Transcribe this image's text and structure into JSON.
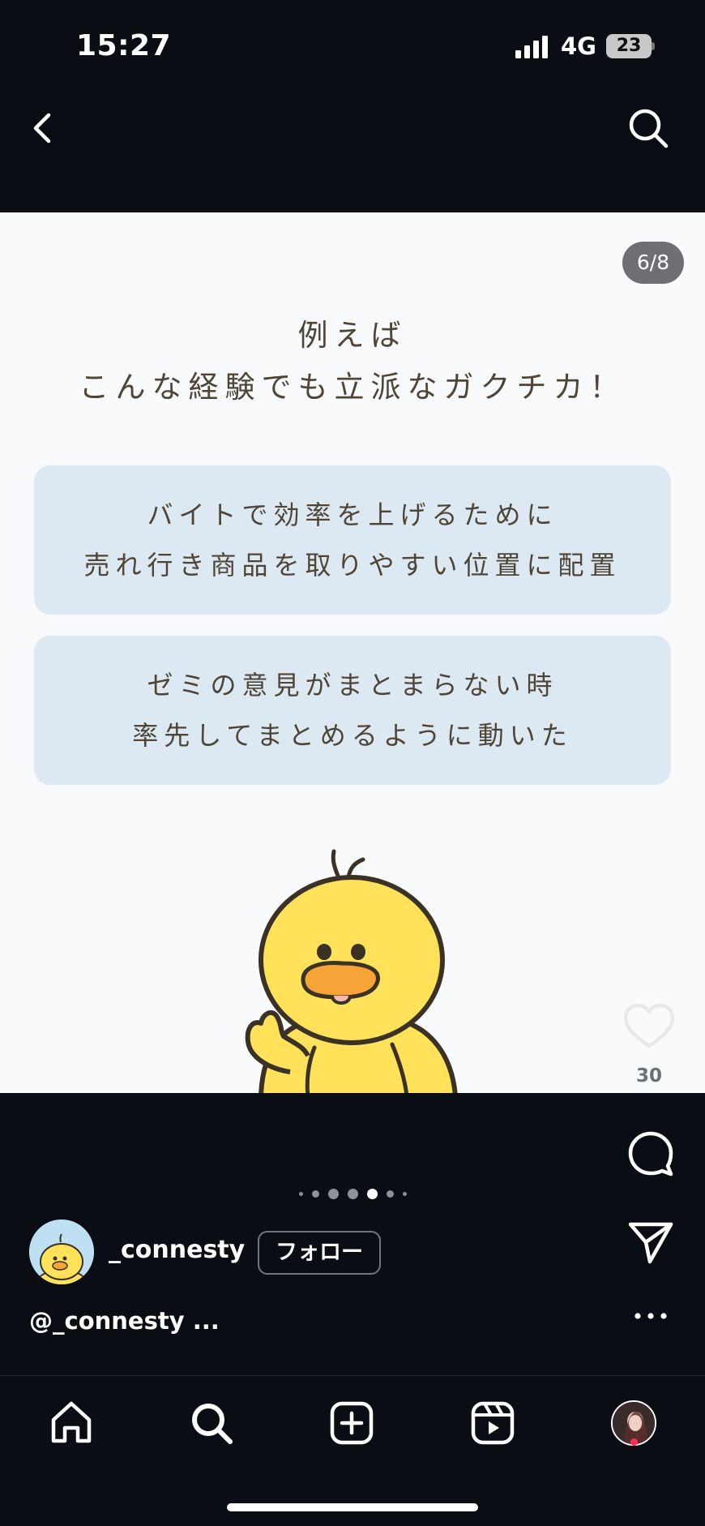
{
  "status_bar": {
    "time": "15:27",
    "network": "4G",
    "battery": "23"
  },
  "header": {
    "back_icon": "chevron-left-icon",
    "search_icon": "search-icon"
  },
  "post": {
    "page_counter": "6/8",
    "title_line1": "例えば",
    "title_line2": "こんな経験でも立派なガクチカ！",
    "cards": [
      {
        "line1": "バイトで効率を上げるために",
        "line2": "売れ行き商品を取りやすい位置に配置"
      },
      {
        "line1": "ゼミの意見がまとまらない時",
        "line2": "率先してまとめるように動いた"
      }
    ],
    "illustration": "yellow-duck-pointing"
  },
  "actions": {
    "like_count": "30",
    "like_icon": "heart-icon",
    "comment_icon": "comment-icon",
    "share_icon": "paper-plane-icon",
    "more_icon": "more-horizontal-icon"
  },
  "carousel": {
    "total": 7,
    "active_index": 4
  },
  "account": {
    "username": "_connesty",
    "follow_label": "フォロー"
  },
  "caption": {
    "text": "@_connesty ..."
  },
  "nav": {
    "items": [
      "home-icon",
      "search-icon",
      "create-icon",
      "reels-icon",
      "profile-avatar"
    ]
  },
  "colors": {
    "background": "#0a0d14",
    "card": "#dce8f2",
    "text_brown": "#4e4536",
    "duck_yellow": "#ffe259",
    "beak_orange": "#f6a338"
  }
}
